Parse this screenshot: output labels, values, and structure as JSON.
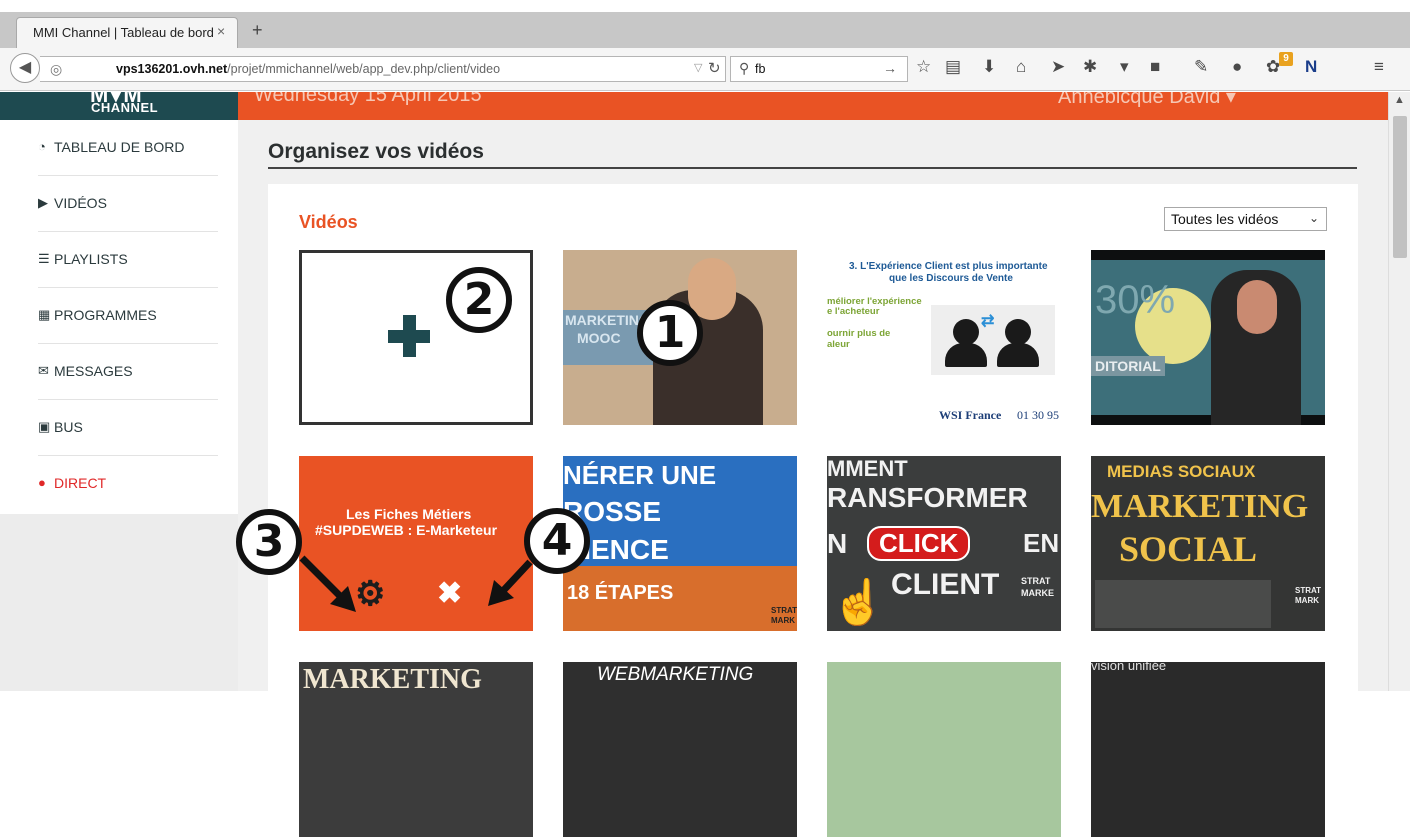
{
  "browser": {
    "tab_title": "MMI Channel | Tableau de bord",
    "tab_close": "×",
    "new_tab": "+",
    "url_host": "vps136201.ovh.net",
    "url_path": "/projet/mmichannel/web/app_dev.php/client/video",
    "search_value": "fb",
    "notification_count": "9"
  },
  "header": {
    "logo_label": "CHANNEL",
    "date": "Wednesday 15 April 2015",
    "user": "Annebicque David ▾",
    "brand_color": "#e95324",
    "logo_bg": "#1e4a50"
  },
  "sidebar": {
    "items": [
      {
        "label": "TABLEAU DE BORD",
        "icon": "dashboard-icon"
      },
      {
        "label": "VIDÉOS",
        "icon": "play-icon"
      },
      {
        "label": "PLAYLISTS",
        "icon": "list-icon"
      },
      {
        "label": "PROGRAMMES",
        "icon": "calendar-icon"
      },
      {
        "label": "MESSAGES",
        "icon": "envelope-icon"
      },
      {
        "label": "BUS",
        "icon": "bus-icon"
      },
      {
        "label": "DIRECT",
        "icon": "record-dot-icon"
      }
    ]
  },
  "main": {
    "page_title": "Organisez vos vidéos",
    "section_title": "Vidéos",
    "filter_value": "Toutes les vidéos",
    "annotations": [
      "1",
      "2",
      "3",
      "4"
    ],
    "thumbs": [
      {
        "kind": "add",
        "text": "+"
      },
      {
        "kind": "image",
        "lines": [
          "MARKETING",
          "MOOC"
        ]
      },
      {
        "kind": "image",
        "lines": [
          "3. L'Expérience Client est plus importante",
          "que les Discours de Vente",
          "méliorer l'expérience",
          "e l'acheteur",
          "ournir plus de",
          "aleur",
          "WSI France",
          "01 30 95"
        ]
      },
      {
        "kind": "image",
        "lines": [
          "30%",
          "DITORIAL"
        ]
      },
      {
        "kind": "selected",
        "lines": [
          "Les Fiches Métiers",
          "#SUPDEWEB : E-Marketeur"
        ]
      },
      {
        "kind": "image",
        "lines": [
          "NÉRER UNE",
          "ROSSE",
          "DIENCE",
          "18 ÉTAPES",
          "STRAT",
          "MARK"
        ]
      },
      {
        "kind": "image",
        "lines": [
          "MMENT",
          "RANSFORMER",
          "N",
          "CLICK",
          "EN",
          "CLIENT",
          "STRAT",
          "MARKE"
        ]
      },
      {
        "kind": "image",
        "lines": [
          "MEDIAS SOCIAUX",
          "MARKETING",
          "SOCIAL",
          "STRAT",
          "MARK"
        ]
      },
      {
        "kind": "image",
        "lines": [
          "MARKETING"
        ]
      },
      {
        "kind": "image",
        "lines": [
          "WEBMARKETING"
        ]
      },
      {
        "kind": "image",
        "lines": []
      },
      {
        "kind": "image",
        "lines": [
          "vision unifiée"
        ]
      }
    ]
  }
}
